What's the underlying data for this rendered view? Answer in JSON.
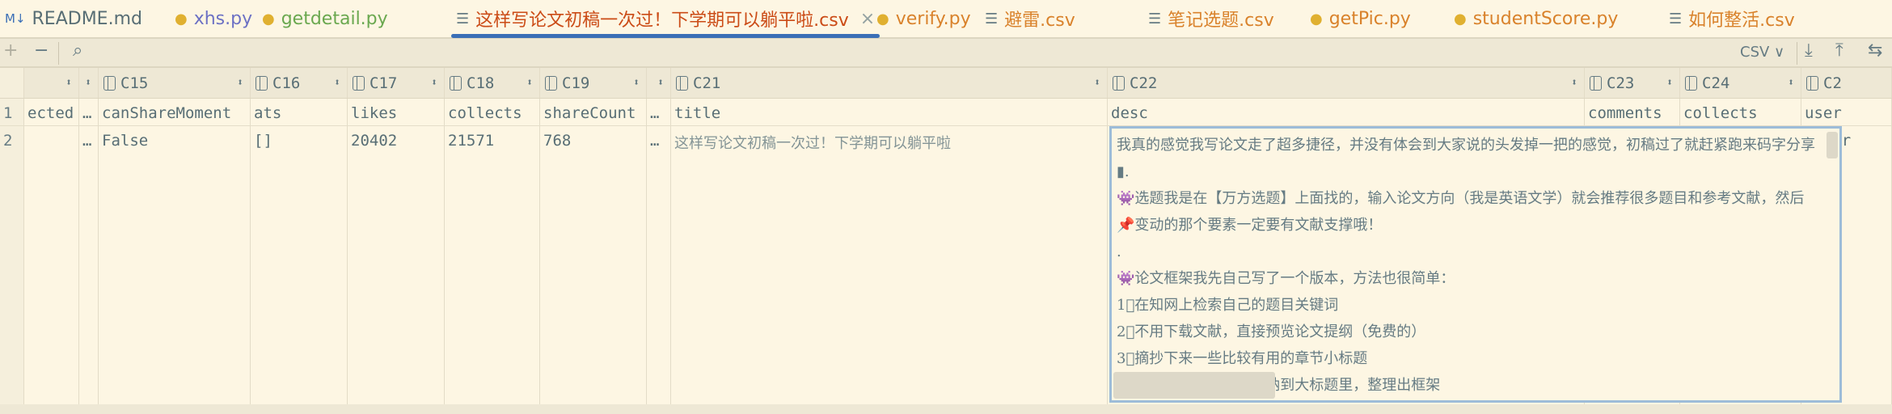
{
  "tabs": [
    {
      "label": "README.md",
      "icon": "markdown-icon",
      "color": "#586e75"
    },
    {
      "label": "xhs.py",
      "icon": "python-icon",
      "color": "#6c71c4"
    },
    {
      "label": "getdetail.py",
      "icon": "python-icon",
      "color": "#6aa84f"
    },
    {
      "label": "这样写论文初稿一次过！下学期可以躺平啦.csv",
      "icon": "csv-icon",
      "color": "#cb4b16",
      "active": true
    },
    {
      "label": "verify.py",
      "icon": "python-icon",
      "color": "#d9822b"
    },
    {
      "label": "避雷.csv",
      "icon": "csv-icon",
      "color": "#d9822b"
    },
    {
      "label": "笔记选题.csv",
      "icon": "csv-icon",
      "color": "#d9822b"
    },
    {
      "label": "getPic.py",
      "icon": "python-icon",
      "color": "#d9822b"
    },
    {
      "label": "studentScore.py",
      "icon": "python-icon",
      "color": "#d9822b"
    },
    {
      "label": "如何整活.csv",
      "icon": "csv-icon",
      "color": "#d9822b"
    }
  ],
  "close_glyph": "×",
  "toolbar": {
    "add": "+",
    "remove": "−",
    "search": "⌕",
    "format": "CSV ∨",
    "download": "⤓",
    "upload": "⤒",
    "transpose": "⇆"
  },
  "columns": [
    {
      "id": "",
      "name": "ected"
    },
    {
      "id": "",
      "name": "…"
    },
    {
      "id": "C15",
      "name": "canShareMoment"
    },
    {
      "id": "C16",
      "name": "ats"
    },
    {
      "id": "C17",
      "name": "likes"
    },
    {
      "id": "C18",
      "name": "collects"
    },
    {
      "id": "C19",
      "name": "shareCount"
    },
    {
      "id": "",
      "name": "…"
    },
    {
      "id": "C21",
      "name": "title"
    },
    {
      "id": "C22",
      "name": "desc"
    },
    {
      "id": "C23",
      "name": "comments"
    },
    {
      "id": "C24",
      "name": "collects"
    },
    {
      "id": "C2",
      "name": "user"
    }
  ],
  "row_numbers": [
    "1",
    "2"
  ],
  "row": [
    "",
    "…",
    "False",
    "[]",
    "20402",
    "21571",
    "768",
    "…",
    "这样写论文初稿一次过！下学期可以躺平啦",
    "",
    "",
    "",
    "{'bar"
  ],
  "desc_lines": [
    "我真的感觉我写论文走了超多捷径，并没有体会到大家说的头发掉一把的感觉，初稿过了就赶紧跑来码字分享",
    "▮.",
    "👾选题我是在【万方选题】上面找的，输入论文方向（我是英语文学）就会推荐很多题目和参考文献，然后",
    "📌变动的那个要素一定要有文献支撑哦！",
    ".",
    "👾论文框架我先自己写了一个版本，方法也很简单：",
    "1⃣在知网上检索自己的题目关键词",
    "2⃣不用下载文献，直接预览论文提纲（免费的）",
    "3⃣摘抄下来一些比较有用的章节小标题",
    "4⃣将这些小标题分类归纳到大标题里，整理出框架"
  ]
}
